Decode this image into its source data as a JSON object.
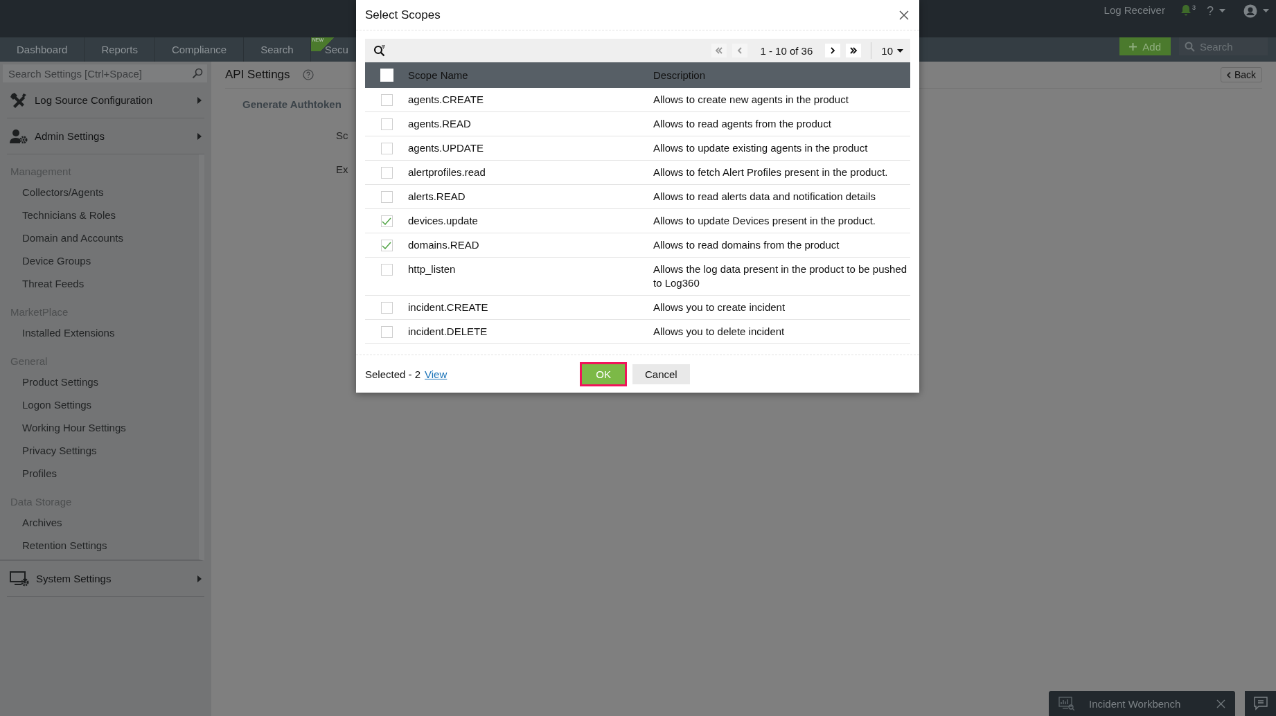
{
  "top_bar": {
    "app_label": "Log Receiver",
    "notification_count": "3",
    "help": "?"
  },
  "nav_tabs": [
    {
      "label": "Dashboard",
      "selected": false
    },
    {
      "label": "Reports",
      "selected": false
    },
    {
      "label": "Compliance",
      "selected": false
    },
    {
      "label": "Search",
      "selected": false
    },
    {
      "label": "Secu",
      "badge": "NEW",
      "selected": false
    }
  ],
  "nav_actions": {
    "add": "Add",
    "search_placeholder": "Search"
  },
  "sidebar": {
    "search_placeholder": "Search Settings [Ctrl+Space]",
    "menus": [
      {
        "label": "Log Source Configuration",
        "kind": "tools"
      },
      {
        "label": "Admin Settings",
        "kind": "admin",
        "groups": [
          {
            "title": "Management",
            "items": [
              "Collectors/Agents",
              "Technicians & Roles",
              "Domain and Accounts",
              "Device Groups",
              "Threat Feeds"
            ]
          },
          {
            "title": "MarketPlace",
            "items": [
              "Installed Extensions"
            ]
          },
          {
            "title": "General",
            "items": [
              "Product Settings",
              "Logon Settings",
              "Working Hour Settings",
              "Privacy Settings",
              "Profiles"
            ]
          },
          {
            "title": "Data Storage",
            "items": [
              "Archives",
              "Retention Settings"
            ]
          }
        ]
      },
      {
        "label": "System Settings",
        "kind": "system"
      }
    ]
  },
  "page": {
    "title": "API Settings",
    "back": "Back",
    "section": "Generate Authtoken",
    "labels": [
      "Sc",
      "Ex"
    ]
  },
  "dialog": {
    "title": "Select Scopes",
    "pagination": {
      "range": "1 - 10 of 36",
      "page_size": "10"
    },
    "columns": [
      "Scope Name",
      "Description"
    ],
    "all_checked": false,
    "rows": [
      {
        "name": "agents.CREATE",
        "description": "Allows to create new agents in the product",
        "checked": false
      },
      {
        "name": "agents.READ",
        "description": "Allows to read agents from the product",
        "checked": false
      },
      {
        "name": "agents.UPDATE",
        "description": "Allows to update existing agents in the product",
        "checked": false
      },
      {
        "name": "alertprofiles.read",
        "description": "Allows to fetch Alert Profiles present in the product.",
        "checked": false
      },
      {
        "name": "alerts.READ",
        "description": "Allows to read alerts data and notification details",
        "checked": false
      },
      {
        "name": "devices.update",
        "description": "Allows to update Devices present in the product.",
        "checked": true
      },
      {
        "name": "domains.READ",
        "description": "Allows to read domains from the product",
        "checked": true
      },
      {
        "name": "http_listen",
        "description": "Allows the log data present in the product to be pushed to Log360",
        "checked": false
      },
      {
        "name": "incident.CREATE",
        "description": "Allows you to create incident",
        "checked": false
      },
      {
        "name": "incident.DELETE",
        "description": "Allows you to delete incident",
        "checked": false
      }
    ],
    "footer": {
      "selected_label": "Selected - 2",
      "view_link": "View",
      "ok": "OK",
      "ok_focused": true,
      "cancel": "Cancel"
    }
  },
  "workbench": {
    "title": "Incident Workbench"
  }
}
